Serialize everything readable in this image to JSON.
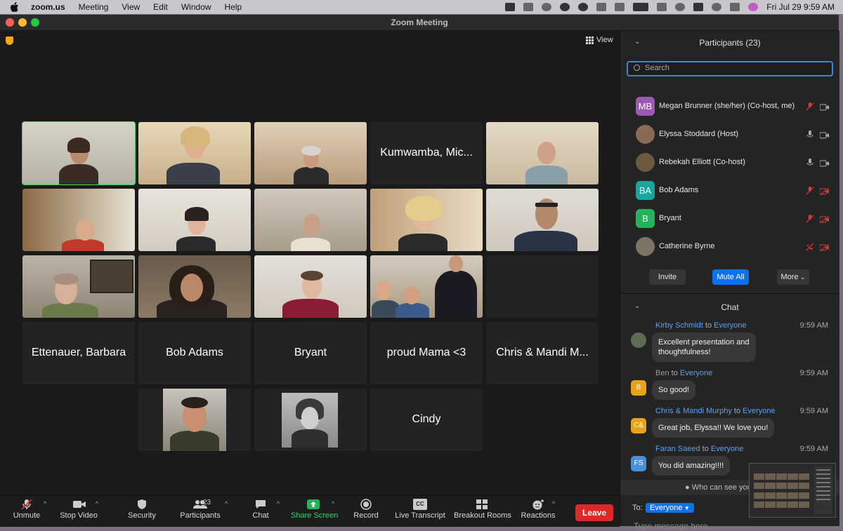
{
  "menubar": {
    "app": "zoom.us",
    "items": [
      "Meeting",
      "View",
      "Edit",
      "Window",
      "Help"
    ],
    "clock": "Fri Jul 29  9:59 AM"
  },
  "window": {
    "title": "Zoom Meeting"
  },
  "stage": {
    "view_label": "View",
    "tiles": [
      {
        "label": ""
      },
      {
        "label": ""
      },
      {
        "label": ""
      },
      {
        "label": "Kumwamba, Mic..."
      },
      {
        "label": ""
      },
      {
        "label": ""
      },
      {
        "label": ""
      },
      {
        "label": ""
      },
      {
        "label": ""
      },
      {
        "label": ""
      },
      {
        "label": ""
      },
      {
        "label": ""
      },
      {
        "label": ""
      },
      {
        "label": ""
      },
      {
        "label": ""
      },
      {
        "label": "Ettenauer, Barbara"
      },
      {
        "label": "Bob Adams"
      },
      {
        "label": "Bryant"
      },
      {
        "label": "proud Mama <3"
      },
      {
        "label": "Chris & Mandi M..."
      },
      {
        "label": ""
      },
      {
        "label": ""
      },
      {
        "label": "Cindy"
      }
    ]
  },
  "controls": {
    "unmute": "Unmute",
    "stop_video": "Stop Video",
    "security": "Security",
    "participants": "Participants",
    "participants_count": "23",
    "chat": "Chat",
    "share_screen": "Share Screen",
    "record": "Record",
    "live_transcript": "Live Transcript",
    "cc_icon": "CC",
    "breakout_rooms": "Breakout Rooms",
    "reactions": "Reactions",
    "leave": "Leave"
  },
  "participants_panel": {
    "title": "Participants (23)",
    "search_placeholder": "Search",
    "people": [
      {
        "initials": "MB",
        "name": "Megan Brunner (she/her) (Co-host, me)",
        "color": "#9b59b6"
      },
      {
        "initials": "",
        "name": "Elyssa Stoddard (Host)",
        "color": "#8a6a55"
      },
      {
        "initials": "",
        "name": "Rebekah Elliott (Co-host)",
        "color": "#6d5a3e"
      },
      {
        "initials": "BA",
        "name": "Bob Adams",
        "color": "#14a7a0"
      },
      {
        "initials": "B",
        "name": "Bryant",
        "color": "#24b35a"
      },
      {
        "initials": "",
        "name": "Catherine Byrne",
        "color": "#7d7466"
      }
    ],
    "invite": "Invite",
    "mute_all": "Mute All",
    "more": "More"
  },
  "chat_panel": {
    "title": "Chat",
    "messages": [
      {
        "sender": "Kirby Schmidt",
        "to": "to",
        "audience": "Everyone",
        "time": "9:59 AM",
        "text_1": "Excellent presentation and",
        "text_2": "thoughtfulness!",
        "initials": "",
        "color": "#5d6b55"
      },
      {
        "sender": "Ben",
        "to": "to",
        "audience": "Everyone",
        "time": "9:59 AM",
        "text_1": "So good!",
        "initials": "B",
        "color": "#e8a317"
      },
      {
        "sender": "Chris & Mandi Murphy",
        "to": "to",
        "audience": "Everyone",
        "time": "9:59 AM",
        "text_1": "Great job, Elyssa!! We love you!",
        "initials": "C&",
        "color": "#e8a317"
      },
      {
        "sender": "Faran Saeed",
        "to": "to",
        "audience": "Everyone",
        "time": "9:59 AM",
        "text_1": "You did amazing!!!!",
        "initials": "FS",
        "color": "#4a90d9"
      }
    ],
    "who_can_see": "Who can see your",
    "to_label": "To:",
    "to_value": "Everyone",
    "input_placeholder": "Type message here..."
  },
  "colors": {
    "accent": "#0e72ed",
    "leave": "#e02828",
    "active_speaker": "#3cd15a",
    "share": "#24b35a"
  }
}
